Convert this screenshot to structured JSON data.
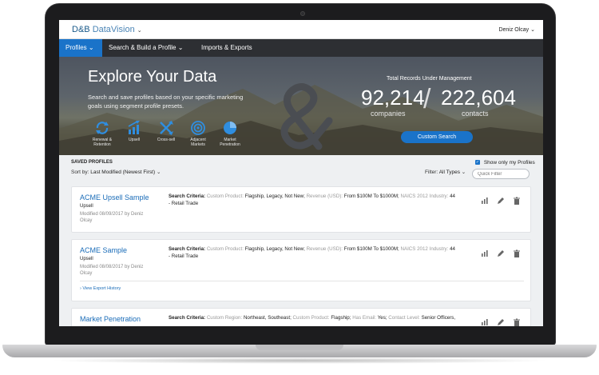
{
  "header": {
    "logo_brand": "D&B",
    "logo_product": "DataVision",
    "user_name": "Deniz Olcay"
  },
  "nav": {
    "items": [
      {
        "label": "Profiles",
        "active": true
      },
      {
        "label": "Search & Build a Profile",
        "active": false
      },
      {
        "label": "Imports & Exports",
        "active": false
      }
    ]
  },
  "hero": {
    "title": "Explore Your Data",
    "description": "Search and save profiles based on your specific marketing goals using segment profile presets.",
    "presets": [
      {
        "label": "Renewal & Retention",
        "icon": "renewal-icon"
      },
      {
        "label": "Upsell",
        "icon": "upsell-icon"
      },
      {
        "label": "Cross-sell",
        "icon": "cross-sell-icon"
      },
      {
        "label": "Adjacent Markets",
        "icon": "adjacent-markets-icon"
      },
      {
        "label": "Market Penetration",
        "icon": "market-penetration-icon"
      }
    ],
    "records_label": "Total Records Under Management",
    "companies_value": "92,214",
    "companies_label": "companies",
    "contacts_value": "222,604",
    "contacts_label": "contacts",
    "custom_search_label": "Custom Search"
  },
  "profiles": {
    "heading": "SAVED PROFILES",
    "sort_label": "Sort by:",
    "sort_value": "Last Modified (Newest First)",
    "show_only_label": "Show only my Profiles",
    "filter_label": "Filter:",
    "filter_value": "All Types",
    "quick_filter_placeholder": "Quick Filter",
    "items": [
      {
        "name": "ACME Upsell Sample",
        "type": "Upsell",
        "modified": "Modified 08/09/2017 by Deniz Olcay",
        "criteria_label": "Search Criteria:",
        "criteria_1_key": "Custom Product:",
        "criteria_1_val": "Flagship, Legacy, Not New;",
        "criteria_2_key": "Revenue (USD):",
        "criteria_2_val": "From $100M To $1000M;",
        "criteria_3_key": "NAICS 2012 Industry:",
        "criteria_3_val": "44 - Retail Trade",
        "export_link": ""
      },
      {
        "name": "ACME Sample",
        "type": "Upsell",
        "modified": "Modified 08/08/2017 by Deniz Olcay",
        "criteria_label": "Search Criteria:",
        "criteria_1_key": "Custom Product:",
        "criteria_1_val": "Flagship, Legacy, Not New;",
        "criteria_2_key": "Revenue (USD):",
        "criteria_2_val": "From $100M To $1000M;",
        "criteria_3_key": "NAICS 2012 Industry:",
        "criteria_3_val": "44 - Retail Trade",
        "export_link": "View Export History"
      },
      {
        "name": "Market Penetration",
        "type": "",
        "modified": "",
        "criteria_label": "Search Criteria:",
        "criteria_1_key": "Custom Region:",
        "criteria_1_val": "Northeast, Southeast;",
        "criteria_2_key": "Custom Product:",
        "criteria_2_val": "Flagship;",
        "criteria_3_key": "Has Email:",
        "criteria_3_val": "Yes;",
        "criteria_4_key": "Contact Level:",
        "criteria_4_val": "Senior Officers,",
        "export_link": ""
      }
    ]
  },
  "colors": {
    "accent": "#1a73c9",
    "nav_bg": "#2d2f33",
    "link": "#1a6cb8"
  }
}
